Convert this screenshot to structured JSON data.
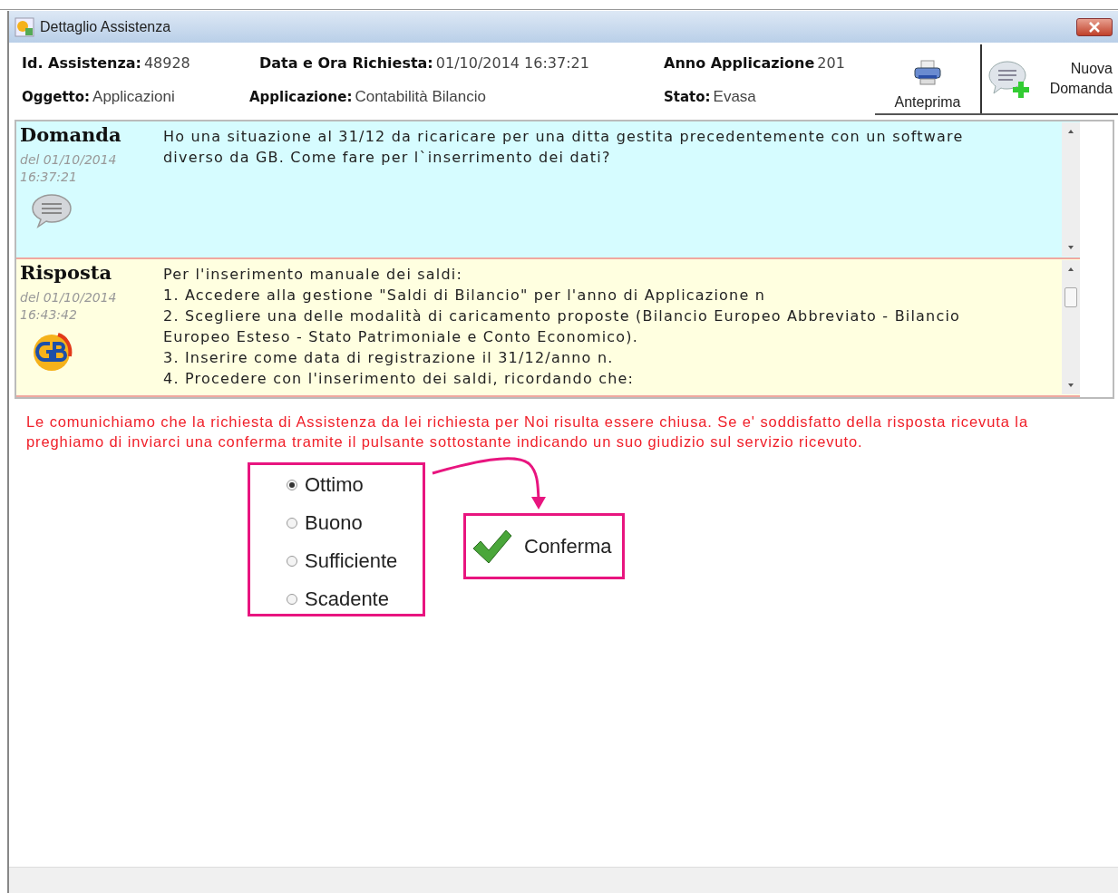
{
  "window": {
    "title": "Dettaglio Assistenza"
  },
  "header": {
    "fields": [
      {
        "label": "Id. Assistenza:",
        "value": "48928"
      },
      {
        "label": "Data e Ora Richiesta:",
        "value": "01/10/2014 16:37:21"
      },
      {
        "label": "Anno Applicazione",
        "value": "201"
      },
      {
        "label": "Oggetto:",
        "value": "Applicazioni"
      },
      {
        "label": "Applicazione:",
        "value": "Contabilità  Bilancio"
      },
      {
        "label": "Stato:",
        "value": "Evasa"
      }
    ],
    "buttons": [
      {
        "kind": "preview",
        "label": "Anteprima"
      },
      {
        "kind": "new",
        "label": "Nuova Domanda"
      }
    ]
  },
  "messages": [
    {
      "kind": "question",
      "title": "Domanda",
      "date": "del 01/10/2014",
      "time": "16:37:21",
      "lines": [
        "Ho una situazione al 31/12 da ricaricare per una ditta gestita precedentemente con un software diverso da GB. Come fare per l`inserrimento dei dati?"
      ]
    },
    {
      "kind": "answer",
      "title": "Risposta",
      "date": "del 01/10/2014",
      "time": "16:43:42",
      "lines": [
        "Per l'inserimento manuale dei saldi:",
        "1. Accedere alla gestione \"Saldi di Bilancio\" per l'anno di Applicazione n",
        "2. Scegliere una delle modalità di caricamento proposte (Bilancio Europeo Abbreviato - Bilancio Europeo Esteso - Stato Patrimoniale e Conto Economico).",
        "3. Inserire come data di registrazione il 31/12/anno n.",
        "4. Procedere con l'inserimento dei saldi, ricordando che:"
      ]
    }
  ],
  "notice": "Le comunichiamo che la richiesta di Assistenza da lei richiesta per Noi risulta essere chiusa. Se e' soddisfatto della risposta ricevuta la preghiamo di inviarci una conferma tramite il pulsante sottostante indicando un suo giudizio sul servizio ricevuto.",
  "rating": {
    "options": [
      {
        "label": "Ottimo",
        "selected": true
      },
      {
        "label": "Buono",
        "selected": false
      },
      {
        "label": "Sufficiente",
        "selected": false
      },
      {
        "label": "Scadente",
        "selected": false
      }
    ]
  },
  "confirm_button": {
    "label": "Conferma"
  }
}
